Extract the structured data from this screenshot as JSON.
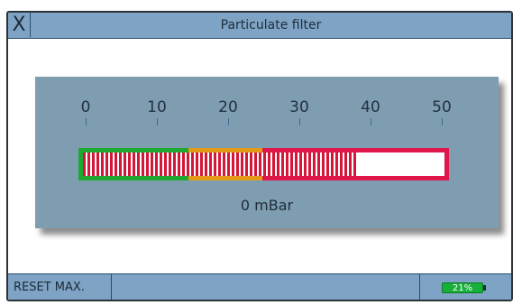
{
  "window": {
    "title": "Particulate filter",
    "close_label": "X"
  },
  "gauge": {
    "scale_min": 0,
    "scale_max": 50,
    "ticks": [
      "0",
      "10",
      "20",
      "30",
      "40",
      "50"
    ],
    "zones": [
      {
        "name": "green",
        "from": 0,
        "to": 15,
        "color": "#1ea832"
      },
      {
        "name": "orange",
        "from": 15,
        "to": 25,
        "color": "#e39a18"
      },
      {
        "name": "red",
        "from": 25,
        "to": 50,
        "color": "#e0174a"
      }
    ],
    "max_indicator": 38,
    "fill_color": "#d41638",
    "value_text": "0 mBar"
  },
  "footer": {
    "reset_label": "RESET MAX.",
    "battery_text": "21%",
    "battery_color": "#16b03a"
  }
}
